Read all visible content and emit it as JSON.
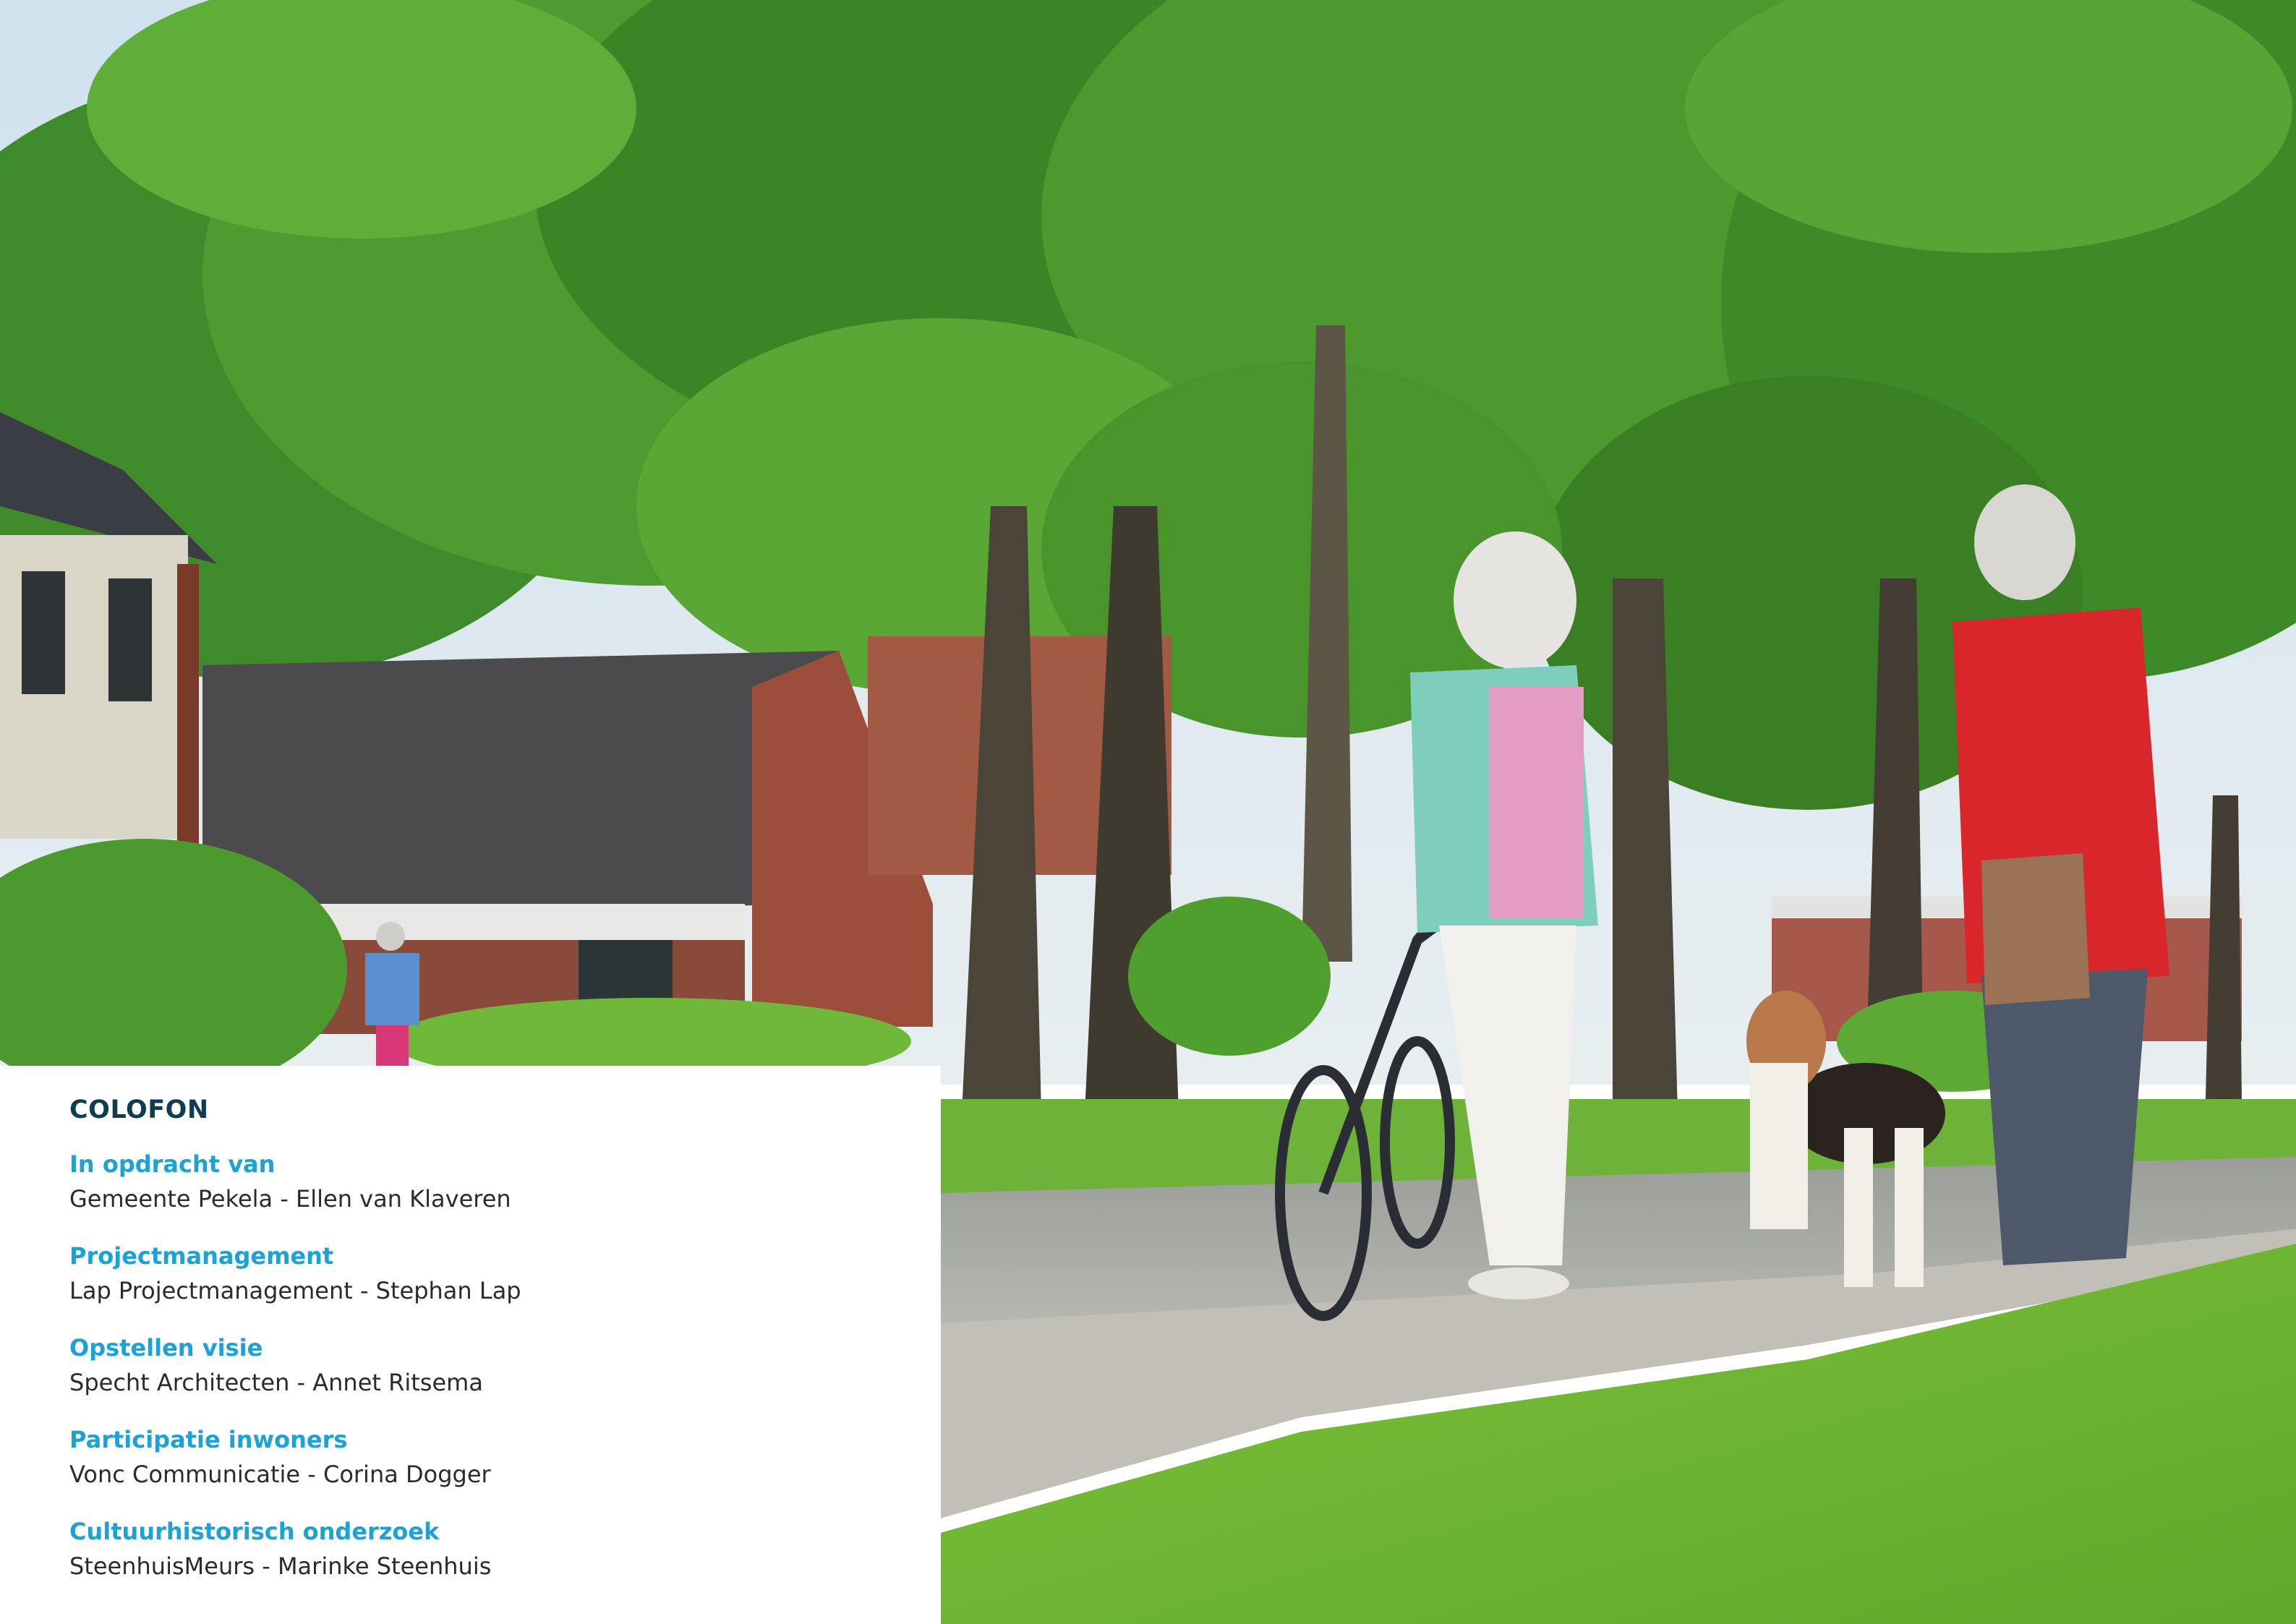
{
  "colofon": {
    "title": "COLOFON",
    "credits": [
      {
        "role": "In opdracht van",
        "name": "Gemeente Pekela - Ellen van Klaveren"
      },
      {
        "role": "Projectmanagement",
        "name": "Lap Projectmanagement - Stephan Lap"
      },
      {
        "role": "Opstellen visie",
        "name": "Specht Architecten - Annet Ritsema"
      },
      {
        "role": "Participatie inwoners",
        "name": "Vonc Communicatie - Corina Dogger"
      },
      {
        "role": "Cultuurhistorisch onderzoek",
        "name": "SteenhuisMeurs - Marinke Steenhuis"
      }
    ]
  },
  "colors": {
    "title": "#0f3d4f",
    "role": "#1ba2d6",
    "text": "#2b2b2b"
  }
}
